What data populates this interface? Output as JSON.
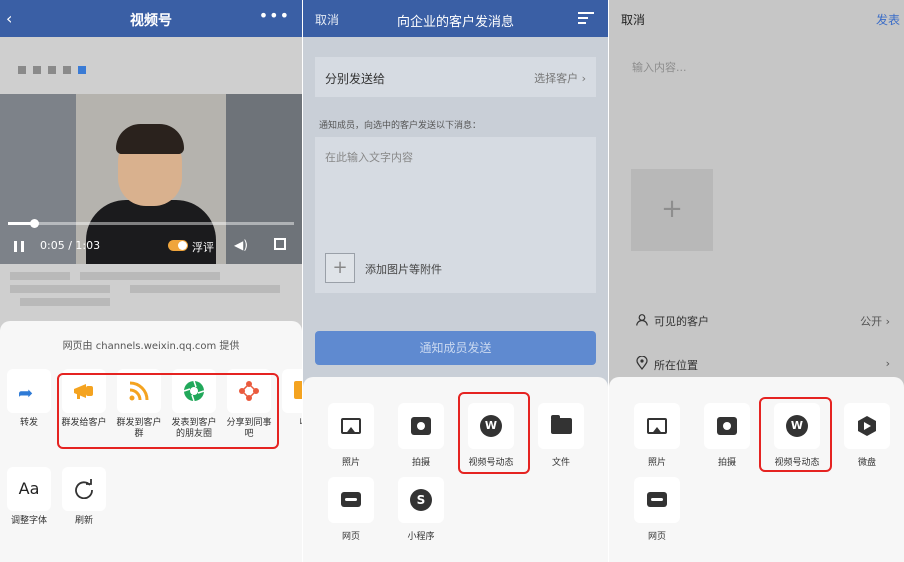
{
  "panel1": {
    "header": {
      "title": "视频号",
      "back_icon": "chevron-left-icon",
      "more_icon": "more-icon"
    },
    "video": {
      "time": "0:05 / 1:03",
      "progress": 0.09,
      "float_label": "浮评"
    },
    "share_sheet": {
      "provider": "网页由 channels.weixin.qq.com 提供",
      "items": [
        {
          "label": "转发",
          "icon": "forward-icon"
        },
        {
          "label": "群发给客户",
          "icon": "megaphone-icon"
        },
        {
          "label": "群发到客户群",
          "icon": "rss-icon"
        },
        {
          "label": "发表到客户的朋友圈",
          "icon": "aperture-icon"
        },
        {
          "label": "分享到同事吧",
          "icon": "nodes-icon"
        },
        {
          "label": "收",
          "icon": "favorite-icon"
        }
      ],
      "row2": [
        {
          "label": "调整字体",
          "icon": "font-icon",
          "glyph": "Aa"
        },
        {
          "label": "刷新",
          "icon": "refresh-icon"
        }
      ]
    }
  },
  "panel2": {
    "header": {
      "cancel": "取消",
      "title": "向企业的客户发消息",
      "menu_icon": "list-settings-icon"
    },
    "send_to": {
      "label": "分别发送给",
      "value": "选择客户 ›"
    },
    "notice": "通知成员，向选中的客户发送以下消息：",
    "text_placeholder": "在此输入文字内容",
    "attach_label": "添加图片等附件",
    "notify_button": "通知成员发送",
    "sheet": [
      {
        "label": "照片",
        "icon": "photo-icon"
      },
      {
        "label": "拍摄",
        "icon": "camera-icon"
      },
      {
        "label": "视频号动态",
        "icon": "channels-icon"
      },
      {
        "label": "文件",
        "icon": "folder-icon"
      },
      {
        "label": "网页",
        "icon": "link-icon"
      },
      {
        "label": "小程序",
        "icon": "miniprogram-icon"
      }
    ]
  },
  "panel3": {
    "header": {
      "cancel": "取消",
      "publish": "发表"
    },
    "input_placeholder": "输入内容...",
    "visible": {
      "label": "可见的客户",
      "value": "公开 ›"
    },
    "location": {
      "label": "所在位置",
      "value": "›"
    },
    "sheet": [
      {
        "label": "照片",
        "icon": "photo-icon"
      },
      {
        "label": "拍摄",
        "icon": "camera-icon"
      },
      {
        "label": "视频号动态",
        "icon": "channels-icon"
      },
      {
        "label": "微盘",
        "icon": "weipan-icon"
      },
      {
        "label": "网页",
        "icon": "link-icon"
      }
    ]
  },
  "colors": {
    "header_blue": "#3a5fa5",
    "highlight_red": "#e52321",
    "accent_blue": "#3b6dc8",
    "orange": "#f0a53c",
    "green": "#21a85a"
  }
}
